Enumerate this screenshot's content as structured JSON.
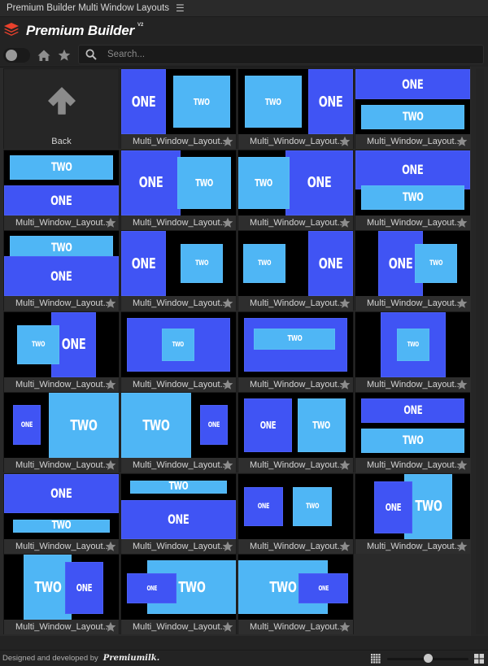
{
  "window": {
    "title": "Premium Builder Multi Window Layouts",
    "menu_icon": "hamburger-menu-icon"
  },
  "brand": {
    "name": "Premium Builder",
    "version": "V2",
    "logo_icon": "layers-stack-icon",
    "logo_color": "#e8412c"
  },
  "toolbar": {
    "toggle_state": "off",
    "home_icon": "home-icon",
    "favorites_icon": "star-icon",
    "search": {
      "placeholder": "Search...",
      "value": ""
    }
  },
  "colors": {
    "window_one": "#4054f4",
    "window_two": "#4fb6f5",
    "thumb_background": "#000000"
  },
  "gallery": {
    "back_label": "Back",
    "tiles": [
      {
        "name": "Multi_Window_Layout...",
        "layout": "left-one-tall_right-two-inset",
        "one": "ONE",
        "two": "TWO"
      },
      {
        "name": "Multi_Window_Layout...",
        "layout": "left-two-inset_right-one-tall",
        "one": "ONE",
        "two": "TWO"
      },
      {
        "name": "Multi_Window_Layout...",
        "layout": "top-one-band_bottom-two-inset",
        "one": "ONE",
        "two": "TWO"
      },
      {
        "name": "Multi_Window_Layout...",
        "layout": "top-two-inset_bottom-one-band",
        "one": "ONE",
        "two": "TWO"
      },
      {
        "name": "Multi_Window_Layout...",
        "layout": "left-one-wide_right-two-overlap",
        "one": "ONE",
        "two": "TWO"
      },
      {
        "name": "Multi_Window_Layout...",
        "layout": "left-two-overlap_right-one-wide",
        "one": "ONE",
        "two": "TWO"
      },
      {
        "name": "Multi_Window_Layout...",
        "layout": "top-one-tall_bottom-two-overlap",
        "one": "ONE",
        "two": "TWO"
      },
      {
        "name": "Multi_Window_Layout...",
        "layout": "top-two-overlap_bottom-one-tall",
        "one": "ONE",
        "two": "TWO"
      },
      {
        "name": "Multi_Window_Layout...",
        "layout": "left-one-tall_right-two-small",
        "one": "ONE",
        "two": "TWO"
      },
      {
        "name": "Multi_Window_Layout...",
        "layout": "left-two-small_right-one-tall",
        "one": "ONE",
        "two": "TWO"
      },
      {
        "name": "Multi_Window_Layout...",
        "layout": "center-one-tall_right-two-overlap",
        "one": "ONE",
        "two": "TWO"
      },
      {
        "name": "Multi_Window_Layout...",
        "layout": "center-one-tall_left-two-overlap",
        "one": "ONE",
        "two": "TWO"
      },
      {
        "name": "Multi_Window_Layout...",
        "layout": "one-full_two-center-small",
        "one": "",
        "two": "TWO"
      },
      {
        "name": "Multi_Window_Layout...",
        "layout": "one-full_two-center-wide",
        "one": "",
        "two": "TWO"
      },
      {
        "name": "Multi_Window_Layout...",
        "layout": "one-square_two-center-small",
        "one": "",
        "two": "TWO"
      },
      {
        "name": "Multi_Window_Layout...",
        "layout": "left-one-small_right-two-large",
        "one": "ONE",
        "two": "TWO"
      },
      {
        "name": "Multi_Window_Layout...",
        "layout": "left-two-large_right-one-small",
        "one": "ONE",
        "two": "TWO"
      },
      {
        "name": "Multi_Window_Layout...",
        "layout": "side-by-side-equal",
        "one": "ONE",
        "two": "TWO"
      },
      {
        "name": "Multi_Window_Layout...",
        "layout": "stacked-equal",
        "one": "ONE",
        "two": "TWO"
      },
      {
        "name": "Multi_Window_Layout...",
        "layout": "top-one-large_bottom-two-thin",
        "one": "ONE",
        "two": "TWO"
      },
      {
        "name": "Multi_Window_Layout...",
        "layout": "top-two-thin_bottom-one-large",
        "one": "ONE",
        "two": "TWO"
      },
      {
        "name": "Multi_Window_Layout...",
        "layout": "side-by-side-small-squares",
        "one": "ONE",
        "two": "TWO"
      },
      {
        "name": "Multi_Window_Layout...",
        "layout": "two-tall-right_one-overlap-left",
        "one": "ONE",
        "two": "TWO"
      },
      {
        "name": "Multi_Window_Layout...",
        "layout": "two-tall-left_one-overlap-right",
        "one": "ONE",
        "two": "TWO"
      },
      {
        "name": "Multi_Window_Layout...",
        "layout": "two-wide-right_one-overlap-left",
        "one": "ONE",
        "two": "TWO"
      },
      {
        "name": "Multi_Window_Layout...",
        "layout": "two-wide-left_one-overlap-right",
        "one": "ONE",
        "two": "TWO"
      }
    ]
  },
  "footer": {
    "credit": "Designed and developed by",
    "logo_text": "Premiumilk.",
    "thumbnail_size_percent": 50,
    "small_size_icon": "small-grid-icon",
    "large_size_icon": "large-grid-icon"
  }
}
